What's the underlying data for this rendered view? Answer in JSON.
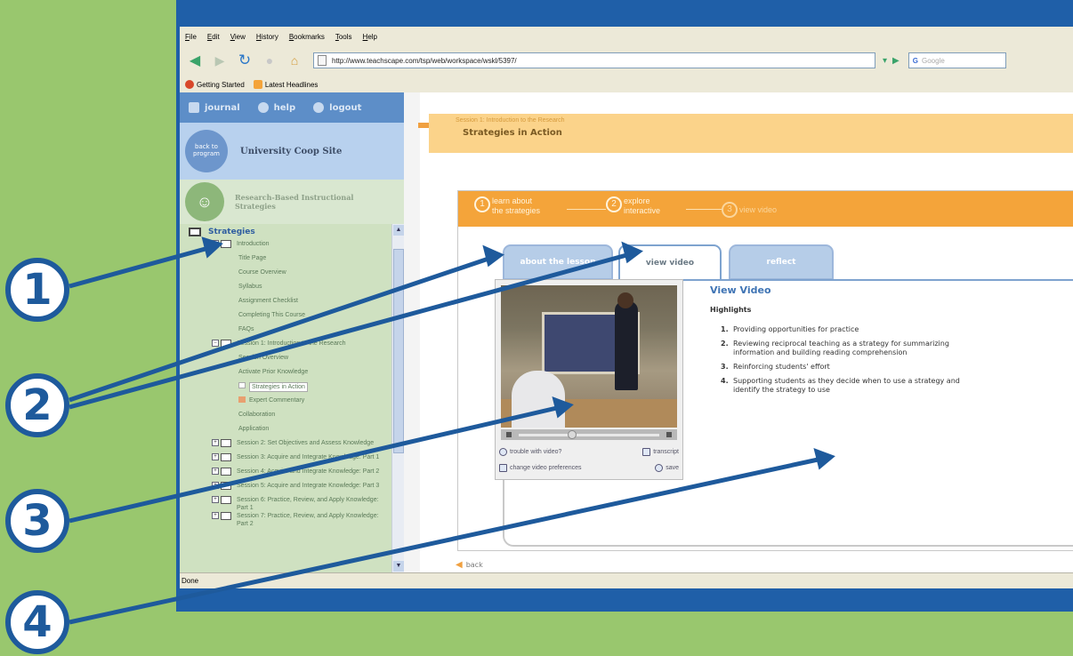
{
  "browser": {
    "menu": [
      "File",
      "Edit",
      "View",
      "History",
      "Bookmarks",
      "Tools",
      "Help"
    ],
    "url": "http://www.teachscape.com/tsp/web/workspace/wskl/5397/",
    "search_placeholder": "Google",
    "bookmarks": [
      "Getting Started",
      "Latest Headlines"
    ],
    "status": "Done"
  },
  "side": {
    "links": [
      "journal",
      "help",
      "logout"
    ],
    "back_to_program": "back to program",
    "site_name": "University Coop Site",
    "module_name_line1": "Research-Based Instructional",
    "module_name_line2": "Strategies",
    "tree_title": "Strategies",
    "tree": [
      {
        "label": "Introduction",
        "level": 0,
        "type": "folder"
      },
      {
        "label": "Title Page",
        "level": 1,
        "type": "page"
      },
      {
        "label": "Course Overview",
        "level": 1,
        "type": "page"
      },
      {
        "label": "Syllabus",
        "level": 1,
        "type": "page"
      },
      {
        "label": "Assignment Checklist",
        "level": 1,
        "type": "page"
      },
      {
        "label": "Completing This Course",
        "level": 1,
        "type": "page"
      },
      {
        "label": "FAQs",
        "level": 1,
        "type": "page"
      },
      {
        "label": "Session 1: Introduction to the Research",
        "level": 0,
        "type": "folder"
      },
      {
        "label": "Session Overview",
        "level": 1,
        "type": "page"
      },
      {
        "label": "Activate Prior Knowledge",
        "level": 1,
        "type": "page"
      },
      {
        "label": "Strategies in Action",
        "level": 1,
        "type": "current"
      },
      {
        "label": "Expert Commentary",
        "level": 1,
        "type": "bullet"
      },
      {
        "label": "Collaboration",
        "level": 1,
        "type": "page"
      },
      {
        "label": "Application",
        "level": 1,
        "type": "page"
      },
      {
        "label": "Session 2: Set Objectives and Assess Knowledge",
        "level": 0,
        "type": "folder"
      },
      {
        "label": "Session 3: Acquire and Integrate Knowledge: Part 1",
        "level": 0,
        "type": "folder"
      },
      {
        "label": "Session 4: Acquire and Integrate Knowledge: Part 2",
        "level": 0,
        "type": "folder"
      },
      {
        "label": "Session 5: Acquire and Integrate Knowledge: Part 3",
        "level": 0,
        "type": "folder"
      },
      {
        "label": "Session 6: Practice, Review, and Apply Knowledge: Part 1",
        "level": 0,
        "type": "folder"
      },
      {
        "label": "Session 7: Practice, Review, and Apply Knowledge: Part 2",
        "level": 0,
        "type": "folder"
      }
    ]
  },
  "main": {
    "session_label": "Session 1: Introduction to the Research",
    "session_title": "Strategies in Action",
    "steps": [
      {
        "num": "1",
        "line1": "learn about",
        "line2": "the strategies"
      },
      {
        "num": "2",
        "line1": "explore",
        "line2": "interactive"
      },
      {
        "num": "3",
        "line1": "view video",
        "line2": ""
      }
    ],
    "tabs": [
      "about the lesson",
      "view video",
      "reflect"
    ],
    "video_links": [
      "trouble with video?",
      "transcript",
      "change video preferences",
      "save"
    ],
    "video_progress": 0.35,
    "heading": "View Video",
    "highlights_label": "Highlights",
    "highlights": [
      "Providing opportunities for practice",
      "Reviewing reciprocal teaching as a strategy for summarizing information and building reading comprehension",
      "Reinforcing students' effort",
      "Supporting students as they decide when to use a strategy and identify the strategy to use"
    ],
    "back": "back"
  },
  "callouts": [
    "1",
    "2",
    "3",
    "4"
  ],
  "colors": {
    "background": "#99c76e",
    "callout": "#1e5a9c",
    "banner": "#f4a43a",
    "tab": "#b6cde8"
  }
}
